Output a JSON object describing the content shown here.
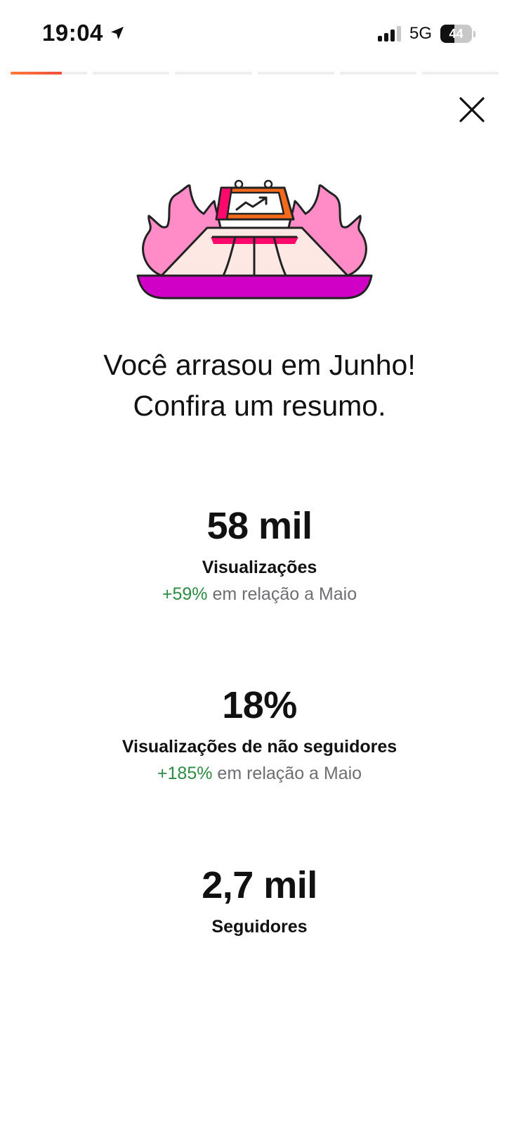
{
  "status_bar": {
    "time": "19:04",
    "network": "5G",
    "battery_level": "44",
    "location_icon": "location-arrow-icon"
  },
  "story_progress": {
    "total_segments": 6,
    "current_segment": 1,
    "current_progress": 0.67,
    "accent_color": "#f25a3a"
  },
  "close": {
    "icon": "close-icon"
  },
  "illustration": {
    "icon": "flaming-stadium-trend-icon",
    "colors": [
      "#ff8cc6",
      "#d100c6",
      "#ff0a6c",
      "#f36a1d",
      "#fde8e4"
    ]
  },
  "headline": {
    "line1": "Você arrasou em Junho!",
    "line2": "Confira um resumo."
  },
  "stats": {
    "views": {
      "value": "58 mil",
      "label": "Visualizações",
      "change_pct": "+59%",
      "change_text": "em relação a Maio"
    },
    "non_followers": {
      "value": "18%",
      "label": "Visualizações de não seguidores",
      "change_pct": "+185%",
      "change_text": "em relação a Maio"
    },
    "followers": {
      "value": "2,7 mil",
      "label": "Seguidores"
    }
  },
  "colors": {
    "positive": "#2e8b46",
    "muted": "#6e6e73",
    "text": "#111111"
  }
}
